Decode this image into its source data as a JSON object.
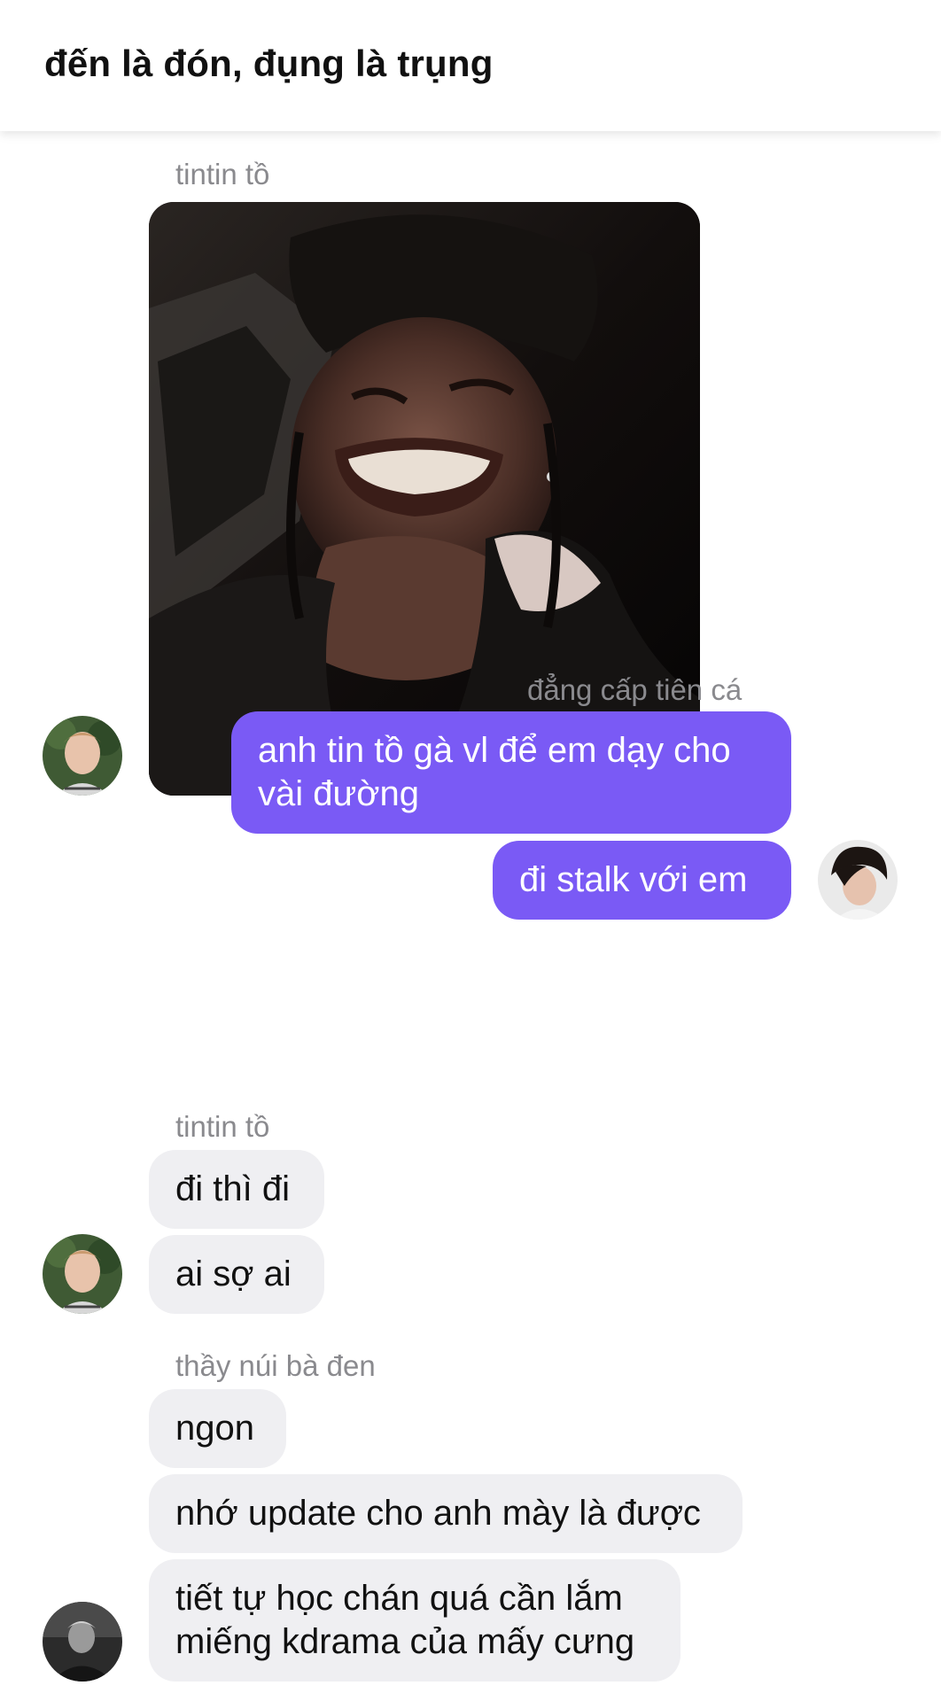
{
  "header": {
    "title": "đến là đón, đụng là trụng"
  },
  "messages": [
    {
      "group": "g1",
      "sender": "tintin tồ",
      "type": "image",
      "image_alt": "photo of a man grimacing and holding his throat inside a car at night"
    },
    {
      "group": "g2",
      "sender": "đẳng cấp tiên cá",
      "bubbles": [
        "anh tin tồ gà vl để em dạy cho vài đường",
        "đi stalk với em"
      ]
    },
    {
      "group": "g3",
      "sender": "tintin tồ",
      "bubbles": [
        "đi thì đi",
        "ai sợ ai"
      ]
    },
    {
      "group": "g4",
      "sender": "thầy núi bà đen",
      "bubbles": [
        "ngon",
        "nhớ update cho anh mày là được",
        "tiết tự học chán quá cần lắm miếng kdrama của mấy cưng"
      ]
    }
  ],
  "colors": {
    "outgoing_bubble": "#7a5af5",
    "incoming_bubble": "#efeff2",
    "sender_name": "#8a8a8e"
  }
}
